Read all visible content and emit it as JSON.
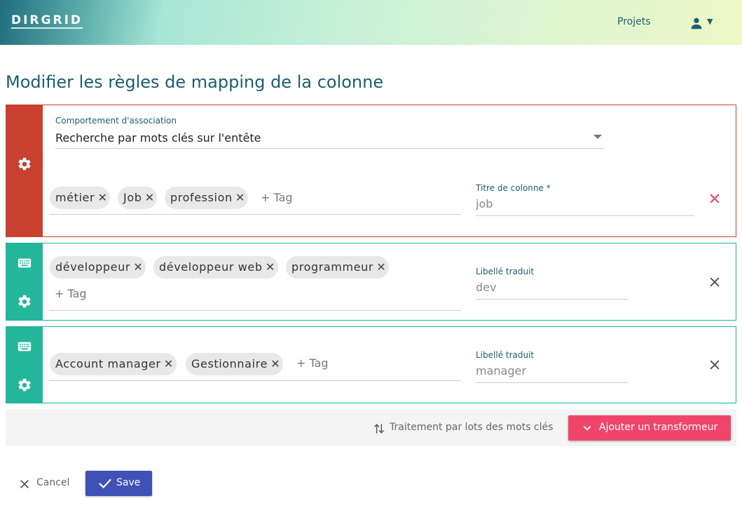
{
  "header": {
    "logo": "DIRGRID",
    "nav_projects": "Projets"
  },
  "page": {
    "title": "Modifier les règles de mapping de la colonne"
  },
  "colors": {
    "header_gradient_start": "#1e6e7e",
    "header_gradient_end": "#eef7c6",
    "primary_text": "#1b5e70",
    "rule_main": "#c9402f",
    "rule_transform": "#23b69a",
    "accent_pink": "#f0456b",
    "save_blue": "#3f51b5"
  },
  "main_rule": {
    "behavior_label": "Comportement d'association",
    "behavior_value": "Recherche par mots clés sur l'entête",
    "tags": [
      "métier",
      "Job",
      "profession"
    ],
    "add_tag_placeholder": "+ Tag",
    "field_label": "Titre de colonne *",
    "field_value": "job",
    "side_icons": [
      "gear-icon"
    ],
    "remove_icon": "close-icon"
  },
  "transforms": [
    {
      "tags": [
        "développeur",
        "développeur web",
        "programmeur"
      ],
      "add_tag_placeholder": "+ Tag",
      "field_label": "Libellé traduit",
      "field_value": "dev",
      "side_icons": [
        "keyboard-icon",
        "gear-icon"
      ],
      "remove_icon": "close-icon"
    },
    {
      "tags": [
        "Account manager",
        "Gestionnaire"
      ],
      "add_tag_placeholder": "+ Tag",
      "field_label": "Libellé traduit",
      "field_value": "manager",
      "side_icons": [
        "keyboard-icon",
        "gear-icon"
      ],
      "remove_icon": "close-icon"
    }
  ],
  "footer_bar": {
    "batch_label": "Traitement par lots des mots clés",
    "add_transform_label": "Ajouter un transformeur"
  },
  "actions": {
    "cancel_label": "Cancel",
    "save_label": "Save"
  }
}
